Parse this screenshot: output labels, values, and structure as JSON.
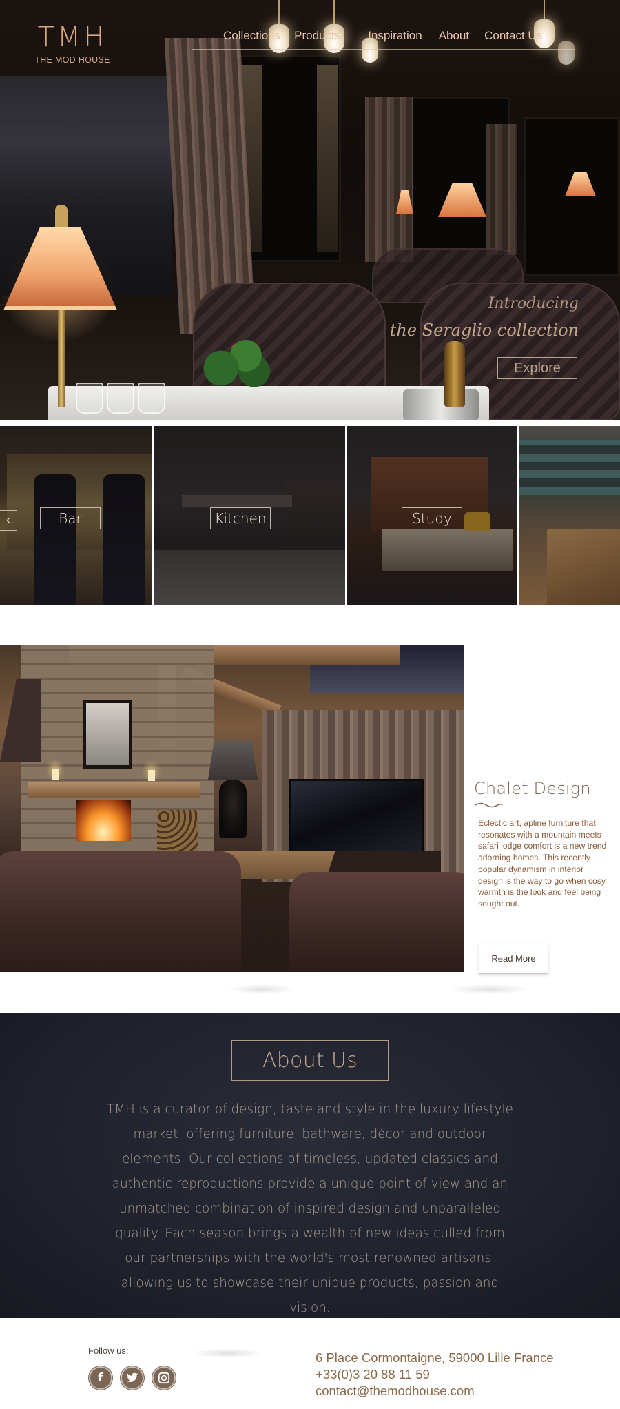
{
  "brand": {
    "logo_mark": "TMH",
    "logo_name": "THE MOD HOUSE"
  },
  "nav": {
    "items": [
      "Collections",
      "Products",
      "Inspiration",
      "About",
      "Contact Us"
    ]
  },
  "hero": {
    "intro_line1": "Introducing",
    "intro_line2": "the Seraglio collection",
    "cta": "Explore"
  },
  "rooms": {
    "prev_arrow": "‹",
    "items": [
      "Bar",
      "Kitchen",
      "Study"
    ]
  },
  "chalet": {
    "title": "Chalet Design",
    "body": "Eclectic art, apline furniture that resonates with a mountain meets safari lodge comfort is a new trend adorning homes. This recently popular dynamism in interior design is the way to go when cosy warmth is the look and feel being sought out.",
    "cta": "Read More"
  },
  "about": {
    "title": "About Us",
    "body": "TMH is a curator of design, taste and style in the luxury lifestyle market, offering furniture, bathware, décor and outdoor elements. Our collections of timeless, updated classics and authentic reproductions provide a unique point of view and an unmatched combination of inspired design and unparalleled quality. Each season brings a wealth of new ideas culled from our partnerships with the world's most renowned artisans, allowing us to showcase their unique products, passion and vision."
  },
  "footer": {
    "follow_label": "Follow us:",
    "social": [
      {
        "name": "facebook-icon",
        "glyph": "f"
      },
      {
        "name": "twitter-icon",
        "glyph": "🐦"
      },
      {
        "name": "instagram-icon",
        "glyph": "◎"
      }
    ],
    "address": "6 Place Cormontaigne, 59000 Lille France",
    "phone": "+33(0)3 20 88 11 59",
    "email": "contact@themodhouse.com"
  },
  "colors": {
    "accent": "#d8a77e",
    "nav_text": "#e6c4a8",
    "about_bg": "#1d1f29",
    "body_text": "#8a5a38",
    "contact_text": "#8a6a4c"
  }
}
